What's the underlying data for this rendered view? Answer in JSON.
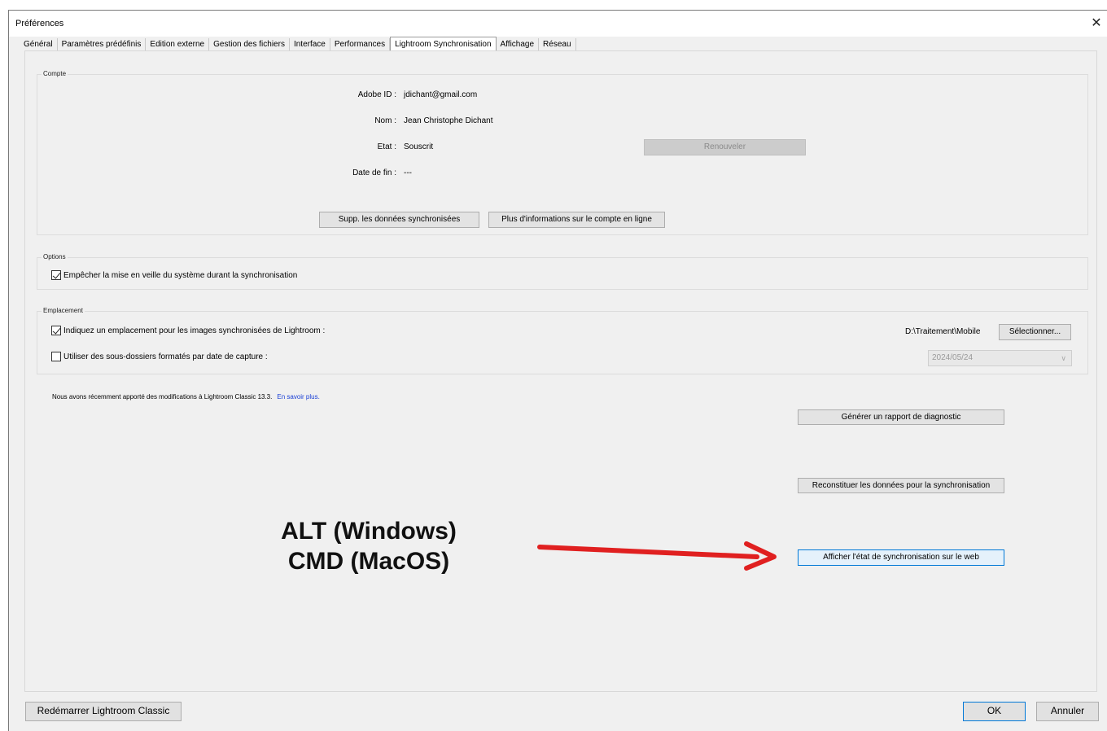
{
  "window": {
    "title": "Préférences",
    "close_glyph": "✕"
  },
  "tabs": [
    {
      "label": "Général",
      "active": false
    },
    {
      "label": "Paramètres prédéfinis",
      "active": false
    },
    {
      "label": "Edition externe",
      "active": false
    },
    {
      "label": "Gestion des fichiers",
      "active": false
    },
    {
      "label": "Interface",
      "active": false
    },
    {
      "label": "Performances",
      "active": false
    },
    {
      "label": "Lightroom Synchronisation",
      "active": true
    },
    {
      "label": "Affichage",
      "active": false
    },
    {
      "label": "Réseau",
      "active": false
    }
  ],
  "compte": {
    "group_label": "Compte",
    "adobe_id_label": "Adobe ID :",
    "adobe_id_value": "jdichant@gmail.com",
    "nom_label": "Nom :",
    "nom_value": "Jean Christophe Dichant",
    "etat_label": "Etat :",
    "etat_value": "Souscrit",
    "renouveler_label": "Renouveler",
    "date_fin_label": "Date de fin :",
    "date_fin_value": "---",
    "supp_button": "Supp. les données synchronisées",
    "plus_info_button": "Plus d'informations sur le compte en ligne"
  },
  "options": {
    "group_label": "Options",
    "prevent_sleep_label": "Empêcher la mise en veille du système durant la synchronisation",
    "prevent_sleep_checked": true
  },
  "emplacement": {
    "group_label": "Emplacement",
    "location_label": "Indiquez un emplacement pour les images synchronisées de Lightroom :",
    "location_checked": true,
    "path_value": "D:\\Traitement\\Mobile",
    "select_button": "Sélectionner...",
    "subfolders_label": "Utiliser des sous-dossiers formatés par date de capture :",
    "subfolders_checked": false,
    "date_format_value": "2024/05/24",
    "dropdown_chevron": "∨"
  },
  "notice": {
    "text": "Nous avons récemment apporté des modifications à Lightroom Classic 13.3.",
    "link": "En savoir plus."
  },
  "actions": {
    "diagnostic_button": "Générer un rapport de diagnostic",
    "rebuild_button": "Reconstituer les données pour la synchronisation",
    "web_status_button": "Afficher l'état de synchronisation sur le web"
  },
  "annotation": {
    "line1": "ALT (Windows)",
    "line2": "CMD (MacOS)",
    "arrow_color": "#e02020"
  },
  "footer": {
    "restart_button": "Redémarrer Lightroom Classic",
    "ok_button": "OK",
    "cancel_button": "Annuler"
  }
}
